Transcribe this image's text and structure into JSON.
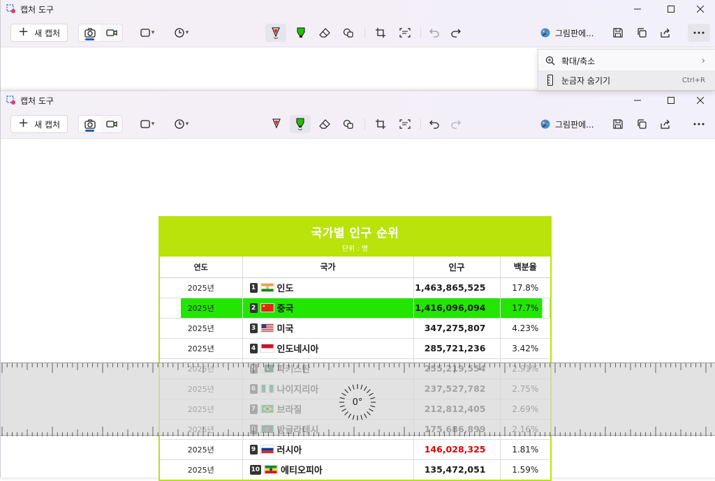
{
  "app": {
    "title": "캡처 도구",
    "new_capture_label": "새 캡처",
    "paint_label": "그림판에..."
  },
  "menu": {
    "items": [
      {
        "label": "확대/축소",
        "right": "›"
      },
      {
        "label": "눈금자 숨기기",
        "right": "Ctrl+R"
      }
    ]
  },
  "ruler": {
    "angle": "0°"
  },
  "table": {
    "title": "국가별 인구 순위",
    "subtitle": "단위 : 명",
    "headers": [
      "연도",
      "국가",
      "인구",
      "백분율"
    ],
    "rows": [
      {
        "year": "2025년",
        "rank": "1",
        "country": "인도",
        "population": "1,463,865,525",
        "percent": "17.8%",
        "flag": "india"
      },
      {
        "year": "2025년",
        "rank": "2",
        "country": "중국",
        "population": "1,416,096,094",
        "percent": "17.7%",
        "flag": "china"
      },
      {
        "year": "2025년",
        "rank": "3",
        "country": "미국",
        "population": "347,275,807",
        "percent": "4.23%",
        "flag": "usa"
      },
      {
        "year": "2025년",
        "rank": "4",
        "country": "인도네시아",
        "population": "285,721,236",
        "percent": "3.42%",
        "flag": "indonesia"
      },
      {
        "year": "2025년",
        "rank": "5",
        "country": "파키스탄",
        "population": "255,219,554",
        "percent": "2.91%",
        "flag": "pakistan"
      },
      {
        "year": "2025년",
        "rank": "6",
        "country": "나이지리아",
        "population": "237,527,782",
        "percent": "2.75%",
        "flag": "nigeria"
      },
      {
        "year": "2025년",
        "rank": "7",
        "country": "브라질",
        "population": "212,812,405",
        "percent": "2.69%",
        "flag": "brazil"
      },
      {
        "year": "2025년",
        "rank": "8",
        "country": "방글라데시",
        "population": "175,686,899",
        "percent": "2.16%",
        "flag": "bangladesh"
      },
      {
        "year": "2025년",
        "rank": "9",
        "country": "러시아",
        "population": "146,028,325",
        "percent": "1.81%",
        "flag": "russia"
      },
      {
        "year": "2025년",
        "rank": "10",
        "country": "에티오피아",
        "population": "135,472,051",
        "percent": "1.59%",
        "flag": "ethiopia"
      }
    ]
  },
  "colors": {
    "accent": "#b9e30b",
    "highlight": "#22e600",
    "pen_red": "#d32f2f",
    "highlighter_green": "#22c000",
    "russia_pop": "#e00000"
  }
}
